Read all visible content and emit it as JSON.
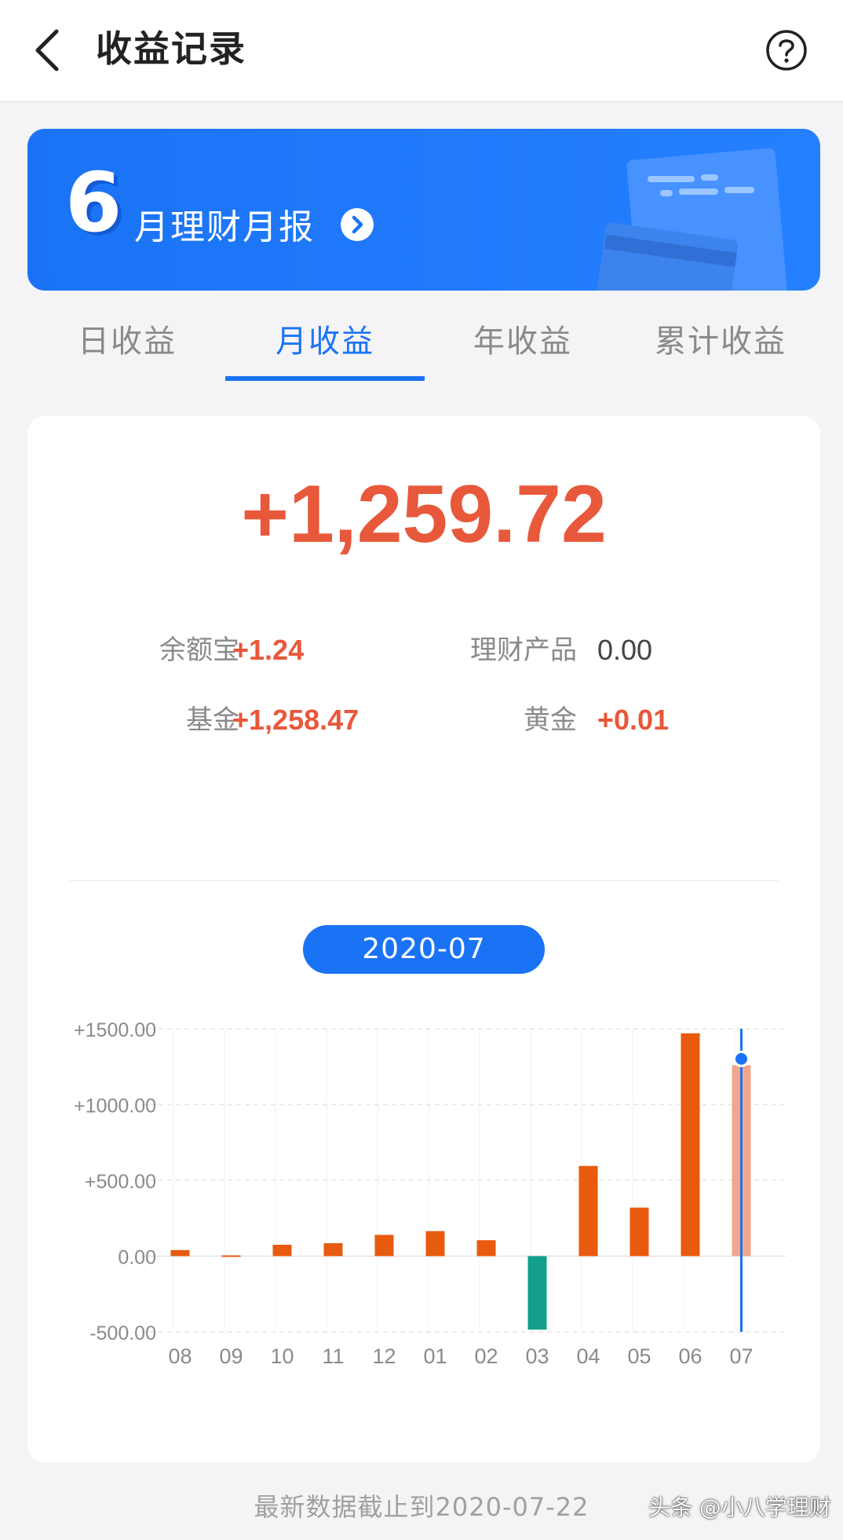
{
  "header": {
    "title": "收益记录"
  },
  "banner": {
    "month_number": "6",
    "text": "月理财月报"
  },
  "tabs": [
    {
      "label": "日收益",
      "active": false
    },
    {
      "label": "月收益",
      "active": true
    },
    {
      "label": "年收益",
      "active": false
    },
    {
      "label": "累计收益",
      "active": false
    }
  ],
  "summary": {
    "total": "+1,259.72",
    "items": [
      {
        "label": "余额宝",
        "value": "+1.24"
      },
      {
        "label": "理财产品",
        "value": "0.00"
      },
      {
        "label": "基金",
        "value": "+1,258.47"
      },
      {
        "label": "黄金",
        "value": "+0.01"
      }
    ]
  },
  "selected_month": "2020-07",
  "chart_data": {
    "type": "bar",
    "categories": [
      "08",
      "09",
      "10",
      "11",
      "12",
      "01",
      "02",
      "03",
      "04",
      "05",
      "06",
      "07"
    ],
    "values": [
      40,
      5,
      75,
      85,
      140,
      165,
      105,
      -485,
      595,
      320,
      1470,
      1259.72
    ],
    "ylim": [
      -500,
      1500
    ],
    "yticks": [
      -500,
      0,
      500,
      1000,
      1500
    ],
    "ytick_labels": [
      "-500.00",
      "0.00",
      "+500.00",
      "+1000.00",
      "+1500.00"
    ],
    "grid": true,
    "selected_index": 11,
    "colors": {
      "positive": "#e85a0e",
      "negative": "#12a08a",
      "selected": "#f0a78d",
      "marker": "#1a73f5"
    }
  },
  "footer": {
    "note": "最新数据截止到2020-07-22",
    "watermark": "头条 @小八学理财"
  },
  "colors": {
    "accent": "#1a73f5",
    "profit": "#e8583a"
  }
}
